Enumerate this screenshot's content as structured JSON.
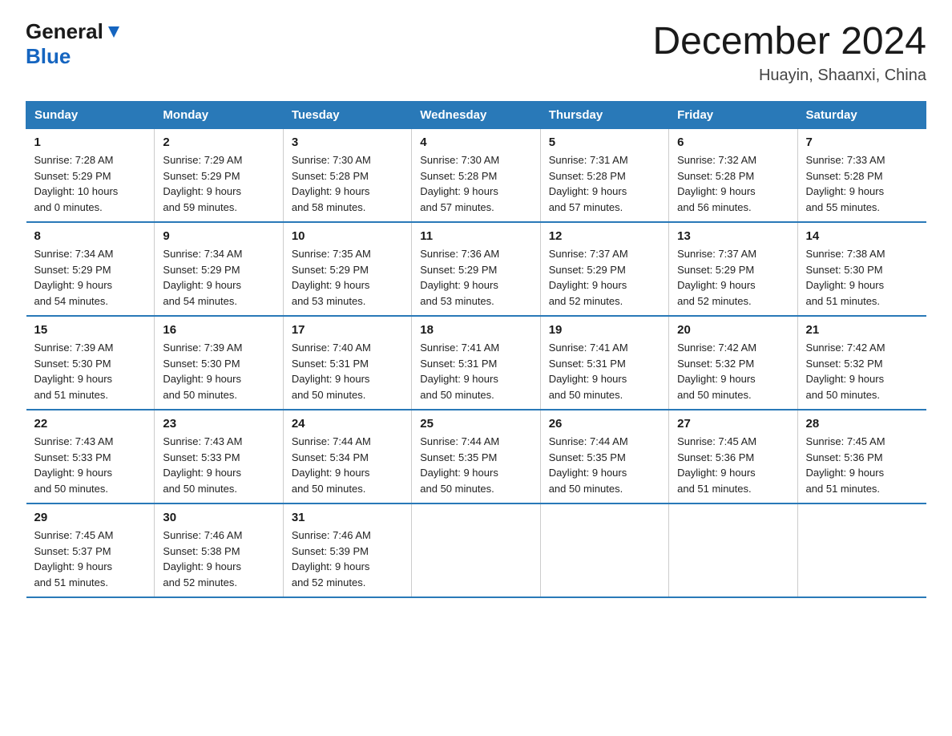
{
  "header": {
    "logo_general": "General",
    "logo_blue": "Blue",
    "title": "December 2024",
    "subtitle": "Huayin, Shaanxi, China"
  },
  "days_of_week": [
    "Sunday",
    "Monday",
    "Tuesday",
    "Wednesday",
    "Thursday",
    "Friday",
    "Saturday"
  ],
  "weeks": [
    [
      {
        "day": "1",
        "sunrise": "7:28 AM",
        "sunset": "5:29 PM",
        "daylight": "10 hours and 0 minutes."
      },
      {
        "day": "2",
        "sunrise": "7:29 AM",
        "sunset": "5:29 PM",
        "daylight": "9 hours and 59 minutes."
      },
      {
        "day": "3",
        "sunrise": "7:30 AM",
        "sunset": "5:28 PM",
        "daylight": "9 hours and 58 minutes."
      },
      {
        "day": "4",
        "sunrise": "7:30 AM",
        "sunset": "5:28 PM",
        "daylight": "9 hours and 57 minutes."
      },
      {
        "day": "5",
        "sunrise": "7:31 AM",
        "sunset": "5:28 PM",
        "daylight": "9 hours and 57 minutes."
      },
      {
        "day": "6",
        "sunrise": "7:32 AM",
        "sunset": "5:28 PM",
        "daylight": "9 hours and 56 minutes."
      },
      {
        "day": "7",
        "sunrise": "7:33 AM",
        "sunset": "5:28 PM",
        "daylight": "9 hours and 55 minutes."
      }
    ],
    [
      {
        "day": "8",
        "sunrise": "7:34 AM",
        "sunset": "5:29 PM",
        "daylight": "9 hours and 54 minutes."
      },
      {
        "day": "9",
        "sunrise": "7:34 AM",
        "sunset": "5:29 PM",
        "daylight": "9 hours and 54 minutes."
      },
      {
        "day": "10",
        "sunrise": "7:35 AM",
        "sunset": "5:29 PM",
        "daylight": "9 hours and 53 minutes."
      },
      {
        "day": "11",
        "sunrise": "7:36 AM",
        "sunset": "5:29 PM",
        "daylight": "9 hours and 53 minutes."
      },
      {
        "day": "12",
        "sunrise": "7:37 AM",
        "sunset": "5:29 PM",
        "daylight": "9 hours and 52 minutes."
      },
      {
        "day": "13",
        "sunrise": "7:37 AM",
        "sunset": "5:29 PM",
        "daylight": "9 hours and 52 minutes."
      },
      {
        "day": "14",
        "sunrise": "7:38 AM",
        "sunset": "5:30 PM",
        "daylight": "9 hours and 51 minutes."
      }
    ],
    [
      {
        "day": "15",
        "sunrise": "7:39 AM",
        "sunset": "5:30 PM",
        "daylight": "9 hours and 51 minutes."
      },
      {
        "day": "16",
        "sunrise": "7:39 AM",
        "sunset": "5:30 PM",
        "daylight": "9 hours and 50 minutes."
      },
      {
        "day": "17",
        "sunrise": "7:40 AM",
        "sunset": "5:31 PM",
        "daylight": "9 hours and 50 minutes."
      },
      {
        "day": "18",
        "sunrise": "7:41 AM",
        "sunset": "5:31 PM",
        "daylight": "9 hours and 50 minutes."
      },
      {
        "day": "19",
        "sunrise": "7:41 AM",
        "sunset": "5:31 PM",
        "daylight": "9 hours and 50 minutes."
      },
      {
        "day": "20",
        "sunrise": "7:42 AM",
        "sunset": "5:32 PM",
        "daylight": "9 hours and 50 minutes."
      },
      {
        "day": "21",
        "sunrise": "7:42 AM",
        "sunset": "5:32 PM",
        "daylight": "9 hours and 50 minutes."
      }
    ],
    [
      {
        "day": "22",
        "sunrise": "7:43 AM",
        "sunset": "5:33 PM",
        "daylight": "9 hours and 50 minutes."
      },
      {
        "day": "23",
        "sunrise": "7:43 AM",
        "sunset": "5:33 PM",
        "daylight": "9 hours and 50 minutes."
      },
      {
        "day": "24",
        "sunrise": "7:44 AM",
        "sunset": "5:34 PM",
        "daylight": "9 hours and 50 minutes."
      },
      {
        "day": "25",
        "sunrise": "7:44 AM",
        "sunset": "5:35 PM",
        "daylight": "9 hours and 50 minutes."
      },
      {
        "day": "26",
        "sunrise": "7:44 AM",
        "sunset": "5:35 PM",
        "daylight": "9 hours and 50 minutes."
      },
      {
        "day": "27",
        "sunrise": "7:45 AM",
        "sunset": "5:36 PM",
        "daylight": "9 hours and 51 minutes."
      },
      {
        "day": "28",
        "sunrise": "7:45 AM",
        "sunset": "5:36 PM",
        "daylight": "9 hours and 51 minutes."
      }
    ],
    [
      {
        "day": "29",
        "sunrise": "7:45 AM",
        "sunset": "5:37 PM",
        "daylight": "9 hours and 51 minutes."
      },
      {
        "day": "30",
        "sunrise": "7:46 AM",
        "sunset": "5:38 PM",
        "daylight": "9 hours and 52 minutes."
      },
      {
        "day": "31",
        "sunrise": "7:46 AM",
        "sunset": "5:39 PM",
        "daylight": "9 hours and 52 minutes."
      },
      null,
      null,
      null,
      null
    ]
  ],
  "labels": {
    "sunrise": "Sunrise:",
    "sunset": "Sunset:",
    "daylight": "Daylight:"
  }
}
